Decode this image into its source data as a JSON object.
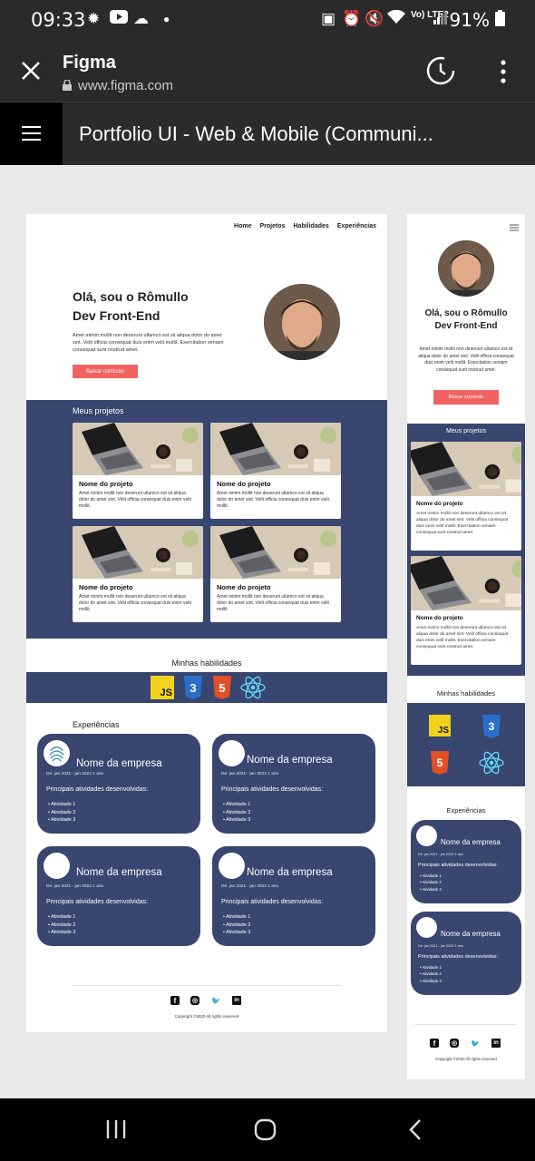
{
  "status": {
    "time": "09:33",
    "battery": "91%",
    "network": "Vo) LTE2"
  },
  "browser": {
    "title": "Figma",
    "url": "www.figma.com"
  },
  "figma": {
    "file_title": "Portfolio UI - Web & Mobile (Communi..."
  },
  "desktop": {
    "nav": [
      "Home",
      "Projetos",
      "Habilidades",
      "Experiências"
    ],
    "hero": {
      "title_line1": "Olá, sou o Rômullo",
      "title_line2": "Dev Front-End",
      "text": "Amet minim mollit non deserunt ullamco est sit aliqua dolor do amet sint. Velit officia consequat duis enim velit mollit. Exercitation veniam consequat sunt nostrud amet.",
      "button": "Baixar currículo"
    },
    "projects": {
      "heading": "Meus projetos",
      "items": [
        {
          "title": "Nome do projeto",
          "text": "Amet minim mollit non deserunt ullamco est sit aliqua dolor do amet sint. Velit officia consequat duis enim velit mollit."
        },
        {
          "title": "Nome do projeto",
          "text": "Amet minim mollit non deserunt ullamco est sit aliqua dolor do amet sint. Velit officia consequat duis enim velit mollit."
        },
        {
          "title": "Nome do projeto",
          "text": "Amet minim mollit non deserunt ullamco est sit aliqua dolor do amet sint. Velit officia consequat duis enim velit mollit."
        },
        {
          "title": "Nome do projeto",
          "text": "Amet minim mollit non deserunt ullamco est sit aliqua dolor do amet sint. Velit officia consequat duis enim velit mollit."
        }
      ]
    },
    "skills": {
      "heading": "Minhas habilidades",
      "js": "JS",
      "css": "3",
      "html": "5"
    },
    "experience": {
      "heading": "Experiências",
      "items": [
        {
          "company": "Nome da empresa",
          "dates": "De: jan 2021 - jan 2022   1 ano",
          "label": "Principais atividades desenvolvidas:",
          "activities": [
            "Atividade 1",
            "Atividade 2",
            "Atividade 3"
          ]
        },
        {
          "company": "Nome da empresa",
          "dates": "De: jan 2021 - jan 2022   1 ano",
          "label": "Principais atividades desenvolvidas:",
          "activities": [
            "Atividade 1",
            "Atividade 2",
            "Atividade 3"
          ]
        },
        {
          "company": "Nome da empresa",
          "dates": "De: jan 2021 - jan 2022   1 ano",
          "label": "Principais atividades desenvolvidas:",
          "activities": [
            "Atividade 1",
            "Atividade 2",
            "Atividade 3"
          ]
        },
        {
          "company": "Nome da empresa",
          "dates": "De: jan 2021 - jan 2022   1 ano",
          "label": "Principais atividades desenvolvidas:",
          "activities": [
            "Atividade 1",
            "Atividade 2",
            "Atividade 3"
          ]
        }
      ]
    },
    "footer": {
      "copyright": "Copyright ©2020 All rights reserved"
    }
  },
  "mobile": {
    "hero": {
      "title_line1": "Olá, sou o Rômullo",
      "title_line2": "Dev Front-End",
      "text": "Amet minim mollit non deserunt ullamco est sit aliqua dolor do amet sint. Velit officia consequat duis enim velit mollit. Exercitation veniam consequat sunt nostrud amet.",
      "button": "Baixar currículo"
    },
    "projects": {
      "heading": "Meus projetos",
      "items": [
        {
          "title": "Nome do projeto",
          "text": "Amet minim mollit non deserunt ullamco est sit aliqua dolor do amet sint. Velit officia consequat duis enim velit mollit. Exercitation veniam consequat sunt nostrud amet."
        },
        {
          "title": "Nome do projeto",
          "text": "Amet minim mollit non deserunt ullamco est sit aliqua dolor do amet sint. Velit officia consequat duis enim velit mollit. Exercitation veniam consequat sunt nostrud amet."
        }
      ]
    },
    "skills": {
      "heading": "Minhas habilidades",
      "js": "JS",
      "css": "3",
      "html": "5"
    },
    "experience": {
      "heading": "Experiências",
      "items": [
        {
          "company": "Nome da empresa",
          "dates": "De: jan 2021 - jan 2022   1 ano",
          "label": "Principais atividades desenvolvidas:",
          "activities": [
            "Atividade 1",
            "Atividade 2",
            "Atividade 3"
          ]
        },
        {
          "company": "Nome da empresa",
          "dates": "De: jan 2021 - jan 2022   1 ano",
          "label": "Principais atividades desenvolvidas:",
          "activities": [
            "Atividade 1",
            "Atividade 2",
            "Atividade 3"
          ]
        }
      ]
    },
    "footer": {
      "copyright": "Copyright ©2020 All rights reserved"
    }
  }
}
